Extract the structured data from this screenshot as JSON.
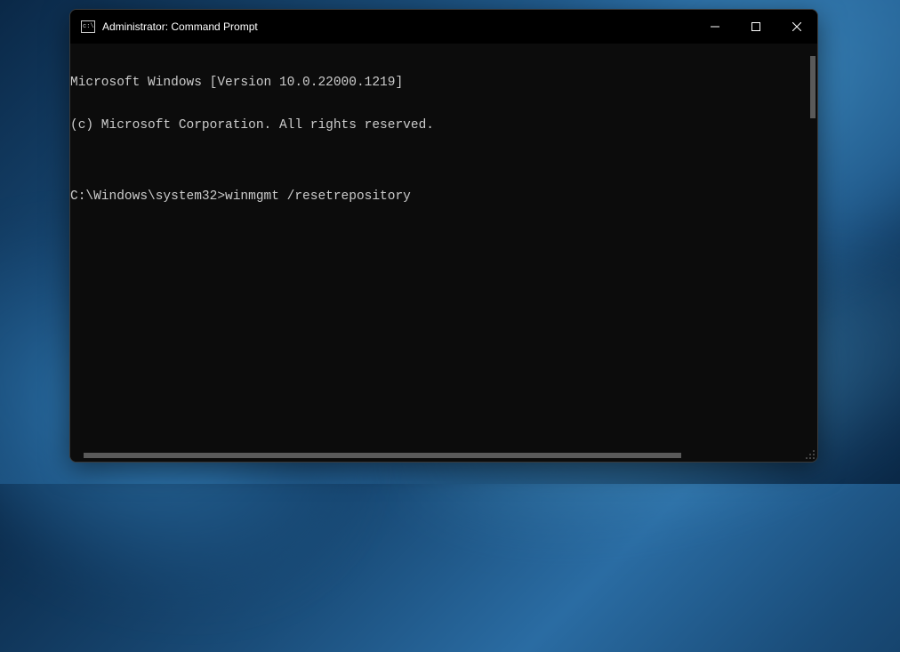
{
  "window": {
    "title": "Administrator: Command Prompt"
  },
  "terminal": {
    "line1": "Microsoft Windows [Version 10.0.22000.1219]",
    "line2": "(c) Microsoft Corporation. All rights reserved.",
    "blank": "",
    "prompt": "C:\\Windows\\system32>",
    "command": "winmgmt /resetrepository"
  }
}
